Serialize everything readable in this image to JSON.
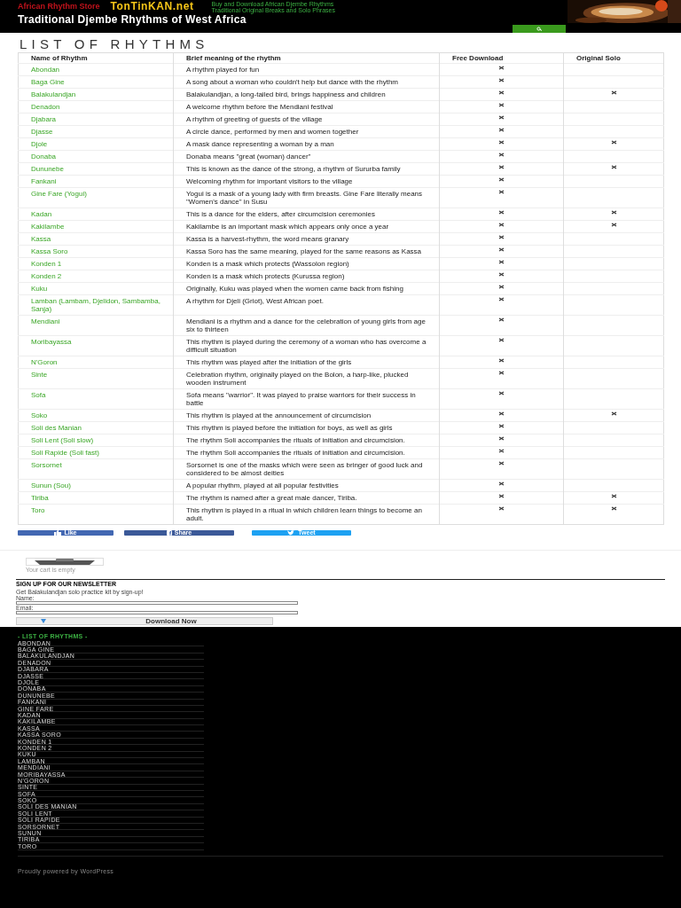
{
  "header": {
    "store_name": "African Rhythm Store",
    "logo": "TonTinKAN.net",
    "taglines": [
      "Buy and Download African Djembe Rhythms",
      "Traditional Original Breaks and Solo Phrases"
    ],
    "site_title": "Traditional Djembe Rhythms of West Africa"
  },
  "page_title": "LIST OF RHYTHMS",
  "table": {
    "columns": [
      "Name of Rhythm",
      "Brief meaning of the rhythm",
      "Free Download",
      "Original Solo"
    ],
    "rows": [
      {
        "name": "Abondan",
        "meaning": "A rhythm played for fun",
        "free_download": true,
        "original_solo": false
      },
      {
        "name": "Baga Gine",
        "meaning": "A song about a woman who couldn't help but dance with the rhythm",
        "free_download": true,
        "original_solo": false
      },
      {
        "name": "Balakulandjan",
        "meaning": "Balakulandjan, a long-tailed bird, brings happiness and children",
        "free_download": true,
        "original_solo": true
      },
      {
        "name": "Denadon",
        "meaning": "A welcome rhythm before the Mendiani festival",
        "free_download": true,
        "original_solo": false
      },
      {
        "name": "Djabara",
        "meaning": "A rhythm of greeting of guests of the village",
        "free_download": true,
        "original_solo": false
      },
      {
        "name": "Djasse",
        "meaning": "A circle dance, performed by men and women together",
        "free_download": true,
        "original_solo": false
      },
      {
        "name": "Djole",
        "meaning": "A mask dance representing a woman by a man",
        "free_download": true,
        "original_solo": true
      },
      {
        "name": "Donaba",
        "meaning": "Donaba means \"great (woman) dancer\"",
        "free_download": true,
        "original_solo": false
      },
      {
        "name": "Dununebe",
        "meaning": "This is known as the dance of the strong, a rhythm of Sururba family",
        "free_download": true,
        "original_solo": true
      },
      {
        "name": "Fankani",
        "meaning": "Welcoming rhythm for important visitors to the village",
        "free_download": true,
        "original_solo": false
      },
      {
        "name": "Gine Fare (Yogui)",
        "meaning": "Yogui is a mask of a young lady with firm breasts. Gine Fare literally means \"Women's dance\" in Susu",
        "free_download": true,
        "original_solo": false
      },
      {
        "name": "Kadan",
        "meaning": "This is a dance for the elders, after circumcision ceremonies",
        "free_download": true,
        "original_solo": true
      },
      {
        "name": "Kakilambe",
        "meaning": "Kakilambe is an important mask which appears only once a year",
        "free_download": true,
        "original_solo": true
      },
      {
        "name": "Kassa",
        "meaning": "Kassa is a harvest-rhythm, the word means granary",
        "free_download": true,
        "original_solo": false
      },
      {
        "name": "Kassa Soro",
        "meaning": "Kassa Soro has the same meaning, played for the same reasons as Kassa",
        "free_download": true,
        "original_solo": false
      },
      {
        "name": "Konden 1",
        "meaning": "Konden is a mask which protects (Wassolon region)",
        "free_download": true,
        "original_solo": false
      },
      {
        "name": "Konden 2",
        "meaning": "Konden is a mask which protects (Kurussa region)",
        "free_download": true,
        "original_solo": false
      },
      {
        "name": "Kuku",
        "meaning": "Originally, Kuku was played when the women came back from fishing",
        "free_download": true,
        "original_solo": false
      },
      {
        "name": "Lamban (Lambam, Djelidon, Sambamba, Sanja)",
        "meaning": "A rhythm for Djeli (Griot), West African poet.",
        "free_download": true,
        "original_solo": false
      },
      {
        "name": "Mendiani",
        "meaning": "Mendiani is a rhythm and a dance for the celebration of young girls from age six to thirteen",
        "free_download": true,
        "original_solo": false
      },
      {
        "name": "Moribayassa",
        "meaning": "This rhythm is played during the ceremony of a woman who has overcome a difficult situation",
        "free_download": true,
        "original_solo": false
      },
      {
        "name": "N'Goron",
        "meaning": "This rhythm was played after the initiation of the girls",
        "free_download": true,
        "original_solo": false
      },
      {
        "name": "Sinte",
        "meaning": "Celebration rhythm, originally played on the Bolon, a harp-like, plucked wooden instrument",
        "free_download": true,
        "original_solo": false
      },
      {
        "name": "Sofa",
        "meaning": "Sofa means \"warrior\". It was played to praise warriors for their success in battle",
        "free_download": true,
        "original_solo": false
      },
      {
        "name": "Soko",
        "meaning": "This rhythm is played at the announcement of circumcision",
        "free_download": true,
        "original_solo": true
      },
      {
        "name": "Soli des Manian",
        "meaning": "This rhythm is played before the initiation for boys, as well as girls",
        "free_download": true,
        "original_solo": false
      },
      {
        "name": "Soli Lent (Soli slow)",
        "meaning": "The rhythm Soli accompanies the rituals of initiation and circumcision.",
        "free_download": true,
        "original_solo": false
      },
      {
        "name": "Soli Rapide (Soli fast)",
        "meaning": "The rhythm Soli accompanies the rituals of initiation and circumcision.",
        "free_download": true,
        "original_solo": false
      },
      {
        "name": "Sorsornet",
        "meaning": "Sorsornet is one of the masks which were seen as bringer of good luck and considered to be almost deities",
        "free_download": true,
        "original_solo": false
      },
      {
        "name": "Sunun (Sou)",
        "meaning": "A popular rhythm, played at all popular festivities",
        "free_download": true,
        "original_solo": false
      },
      {
        "name": "Tiriba",
        "meaning": "The rhythm is named after a great male dancer, Tiriba.",
        "free_download": true,
        "original_solo": true
      },
      {
        "name": "Toro",
        "meaning": "This rhythm is played in a ritual in which children learn things to become an adult.",
        "free_download": true,
        "original_solo": true
      }
    ]
  },
  "social_buttons": [
    {
      "kind": "like",
      "label": "Like"
    },
    {
      "kind": "share",
      "label": "Share"
    },
    {
      "kind": "tweet",
      "label": "Tweet"
    }
  ],
  "cart": {
    "message": "Your cart is empty"
  },
  "newsletter": {
    "title": "SIGN UP FOR OUR NEWSLETTER",
    "text": "Get Balakulandjan solo practice kit by sign-up!",
    "fields": [
      {
        "label": "Name:"
      },
      {
        "label": "Email:"
      }
    ],
    "button": "Download Now"
  },
  "footer": {
    "title": "- LIST OF RHYTHMS -",
    "items": [
      "ABONDAN",
      "BAGA GINE",
      "BALAKULANDJAN",
      "DENADON",
      "DJABARA",
      "DJASSE",
      "DJOLE",
      "DONABA",
      "DUNUNEBE",
      "FANKANI",
      "GINE FARE",
      "KADAN",
      "KAKILAMBE",
      "KASSA",
      "KASSA SORO",
      "KONDEN 1",
      "KONDEN 2",
      "KUKU",
      "LAMBAN",
      "MENDIANI",
      "MORIBAYASSA",
      "N'GORON",
      "SINTE",
      "SOFA",
      "SOKO",
      "SOLI DES MANIAN",
      "SOLI LENT",
      "SOLI RAPIDE",
      "SORSORNET",
      "SUNUN",
      "TIRIBA",
      "TORO"
    ],
    "credit": "Proudly powered by WordPress"
  }
}
